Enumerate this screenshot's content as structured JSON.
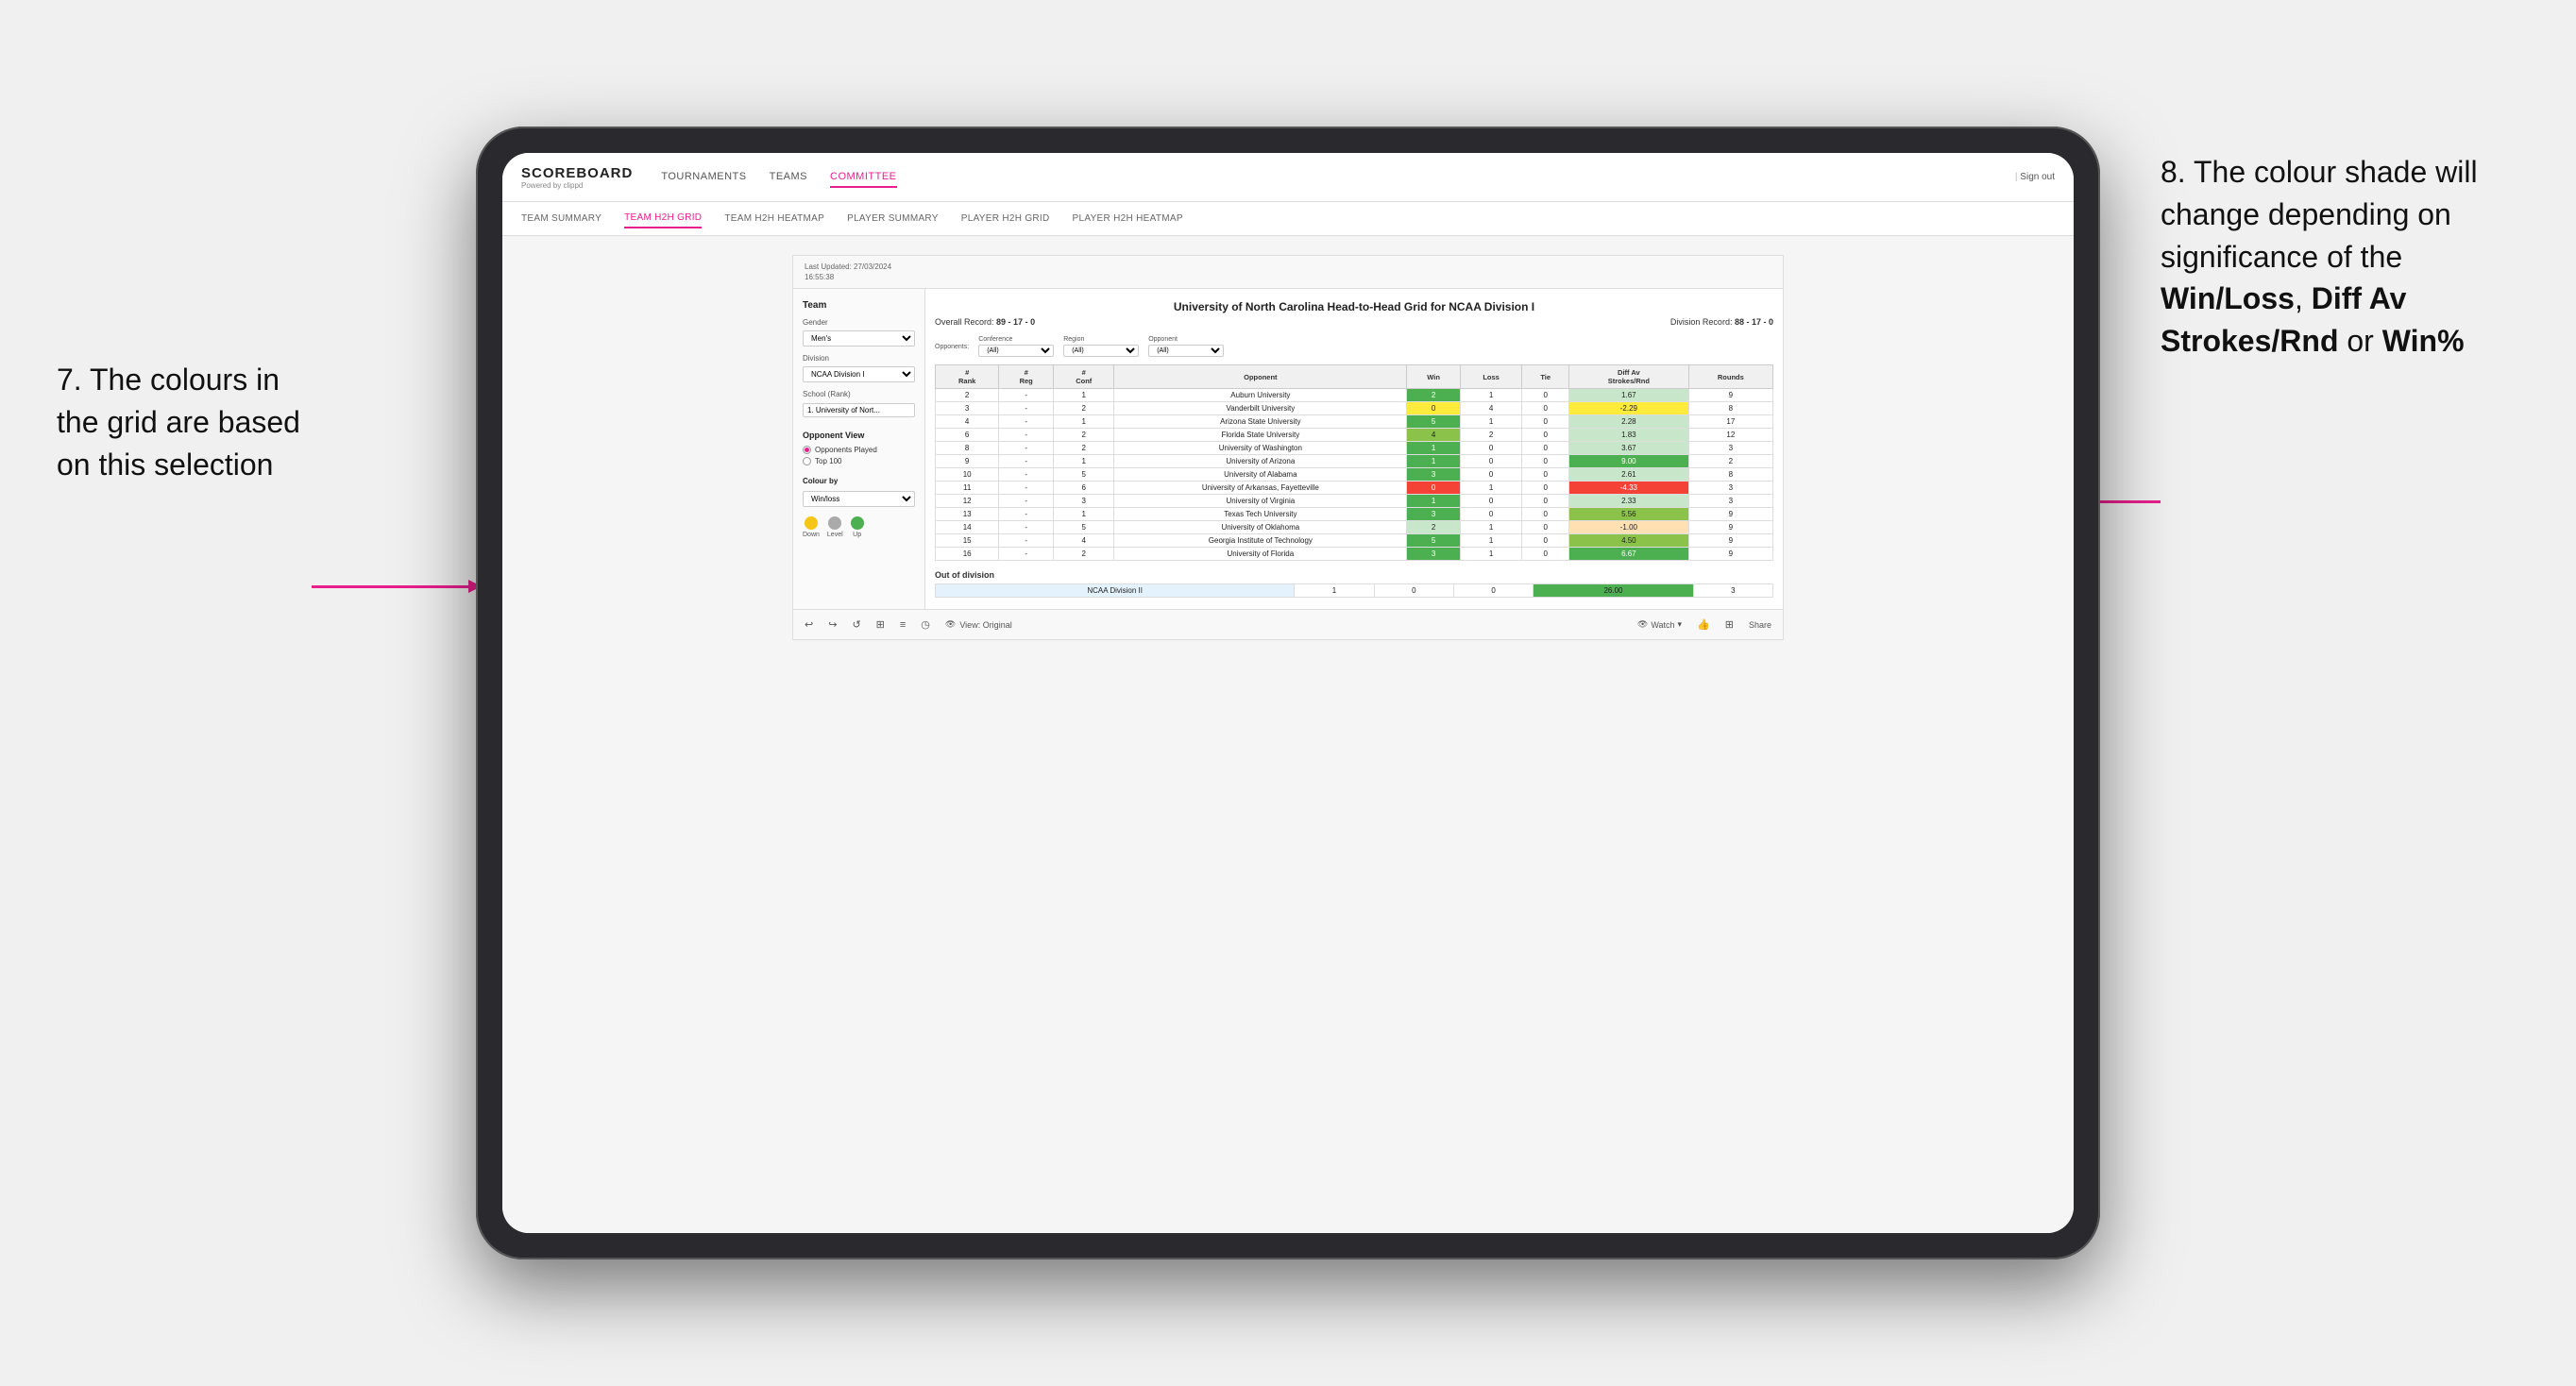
{
  "annotations": {
    "left_text": "7. The colours in the grid are based on this selection",
    "right_text_1": "8. The colour shade will change depending on significance of the ",
    "right_bold_1": "Win/Loss",
    "right_text_2": ", ",
    "right_bold_2": "Diff Av Strokes/Rnd",
    "right_text_3": " or ",
    "right_bold_3": "Win%"
  },
  "nav": {
    "logo": "SCOREBOARD",
    "logo_sub": "Powered by clippd",
    "links": [
      "TOURNAMENTS",
      "TEAMS",
      "COMMITTEE"
    ],
    "sign_out": "Sign out"
  },
  "sub_nav": {
    "links": [
      "TEAM SUMMARY",
      "TEAM H2H GRID",
      "TEAM H2H HEATMAP",
      "PLAYER SUMMARY",
      "PLAYER H2H GRID",
      "PLAYER H2H HEATMAP"
    ],
    "active": "TEAM H2H GRID"
  },
  "tableau": {
    "last_updated_label": "Last Updated: 27/03/2024",
    "last_updated_time": "16:55:38",
    "title": "University of North Carolina Head-to-Head Grid for NCAA Division I",
    "overall_record_label": "Overall Record:",
    "overall_record": "89 - 17 - 0",
    "division_record_label": "Division Record:",
    "division_record": "88 - 17 - 0",
    "left_panel": {
      "team_label": "Team",
      "gender_label": "Gender",
      "gender_value": "Men's",
      "division_label": "Division",
      "division_value": "NCAA Division I",
      "school_label": "School (Rank)",
      "school_value": "1. University of Nort...",
      "opponent_view_label": "Opponent View",
      "radio_options": [
        "Opponents Played",
        "Top 100"
      ],
      "radio_selected": "Opponents Played",
      "colour_by_label": "Colour by",
      "colour_by_value": "Win/loss",
      "legend": [
        {
          "color": "#f5c518",
          "label": "Down"
        },
        {
          "color": "#aaa",
          "label": "Level"
        },
        {
          "color": "#4caf50",
          "label": "Up"
        }
      ]
    },
    "filters": {
      "conference_label": "Conference",
      "conference_value": "(All)",
      "region_label": "Region",
      "region_value": "(All)",
      "opponent_label": "Opponent",
      "opponent_value": "(All)"
    },
    "opponents_label": "Opponents:",
    "table_headers": [
      "#\nRank",
      "#\nReg",
      "#\nConf",
      "Opponent",
      "Win",
      "Loss",
      "Tie",
      "Diff Av\nStrokes/Rnd",
      "Rounds"
    ],
    "rows": [
      {
        "rank": "2",
        "reg": "-",
        "conf": "1",
        "opponent": "Auburn University",
        "win": "2",
        "loss": "1",
        "tie": "0",
        "diff": "1.67",
        "rounds": "9",
        "win_color": "green_dark",
        "diff_color": "green_light"
      },
      {
        "rank": "3",
        "reg": "-",
        "conf": "2",
        "opponent": "Vanderbilt University",
        "win": "0",
        "loss": "4",
        "tie": "0",
        "diff": "-2.29",
        "rounds": "8",
        "win_color": "yellow",
        "diff_color": "yellow"
      },
      {
        "rank": "4",
        "reg": "-",
        "conf": "1",
        "opponent": "Arizona State University",
        "win": "5",
        "loss": "1",
        "tie": "0",
        "diff": "2.28",
        "rounds": "17",
        "win_color": "green_dark",
        "diff_color": "green_light"
      },
      {
        "rank": "6",
        "reg": "-",
        "conf": "2",
        "opponent": "Florida State University",
        "win": "4",
        "loss": "2",
        "tie": "0",
        "diff": "1.83",
        "rounds": "12",
        "win_color": "green_mid",
        "diff_color": "green_light"
      },
      {
        "rank": "8",
        "reg": "-",
        "conf": "2",
        "opponent": "University of Washington",
        "win": "1",
        "loss": "0",
        "tie": "0",
        "diff": "3.67",
        "rounds": "3",
        "win_color": "green_dark",
        "diff_color": "green_light"
      },
      {
        "rank": "9",
        "reg": "-",
        "conf": "1",
        "opponent": "University of Arizona",
        "win": "1",
        "loss": "0",
        "tie": "0",
        "diff": "9.00",
        "rounds": "2",
        "win_color": "green_dark",
        "diff_color": "green_dark"
      },
      {
        "rank": "10",
        "reg": "-",
        "conf": "5",
        "opponent": "University of Alabama",
        "win": "3",
        "loss": "0",
        "tie": "0",
        "diff": "2.61",
        "rounds": "8",
        "win_color": "green_dark",
        "diff_color": "green_light"
      },
      {
        "rank": "11",
        "reg": "-",
        "conf": "6",
        "opponent": "University of Arkansas, Fayetteville",
        "win": "0",
        "loss": "1",
        "tie": "0",
        "diff": "-4.33",
        "rounds": "3",
        "win_color": "red",
        "diff_color": "red"
      },
      {
        "rank": "12",
        "reg": "-",
        "conf": "3",
        "opponent": "University of Virginia",
        "win": "1",
        "loss": "0",
        "tie": "0",
        "diff": "2.33",
        "rounds": "3",
        "win_color": "green_dark",
        "diff_color": "green_light"
      },
      {
        "rank": "13",
        "reg": "-",
        "conf": "1",
        "opponent": "Texas Tech University",
        "win": "3",
        "loss": "0",
        "tie": "0",
        "diff": "5.56",
        "rounds": "9",
        "win_color": "green_dark",
        "diff_color": "green_mid"
      },
      {
        "rank": "14",
        "reg": "-",
        "conf": "5",
        "opponent": "University of Oklahoma",
        "win": "2",
        "loss": "1",
        "tie": "0",
        "diff": "-1.00",
        "rounds": "9",
        "win_color": "green_light",
        "diff_color": "orange_light"
      },
      {
        "rank": "15",
        "reg": "-",
        "conf": "4",
        "opponent": "Georgia Institute of Technology",
        "win": "5",
        "loss": "1",
        "tie": "0",
        "diff": "4.50",
        "rounds": "9",
        "win_color": "green_dark",
        "diff_color": "green_mid"
      },
      {
        "rank": "16",
        "reg": "-",
        "conf": "2",
        "opponent": "University of Florida",
        "win": "3",
        "loss": "1",
        "tie": "0",
        "diff": "6.67",
        "rounds": "9",
        "win_color": "green_dark",
        "diff_color": "green_dark"
      }
    ],
    "out_of_division": {
      "title": "Out of division",
      "rows": [
        {
          "division": "NCAA Division II",
          "win": "1",
          "loss": "0",
          "tie": "0",
          "diff": "26.00",
          "rounds": "3",
          "diff_color": "green_dark"
        }
      ]
    },
    "bottom_bar": {
      "view_label": "View: Original",
      "watch_label": "Watch",
      "share_label": "Share"
    }
  }
}
